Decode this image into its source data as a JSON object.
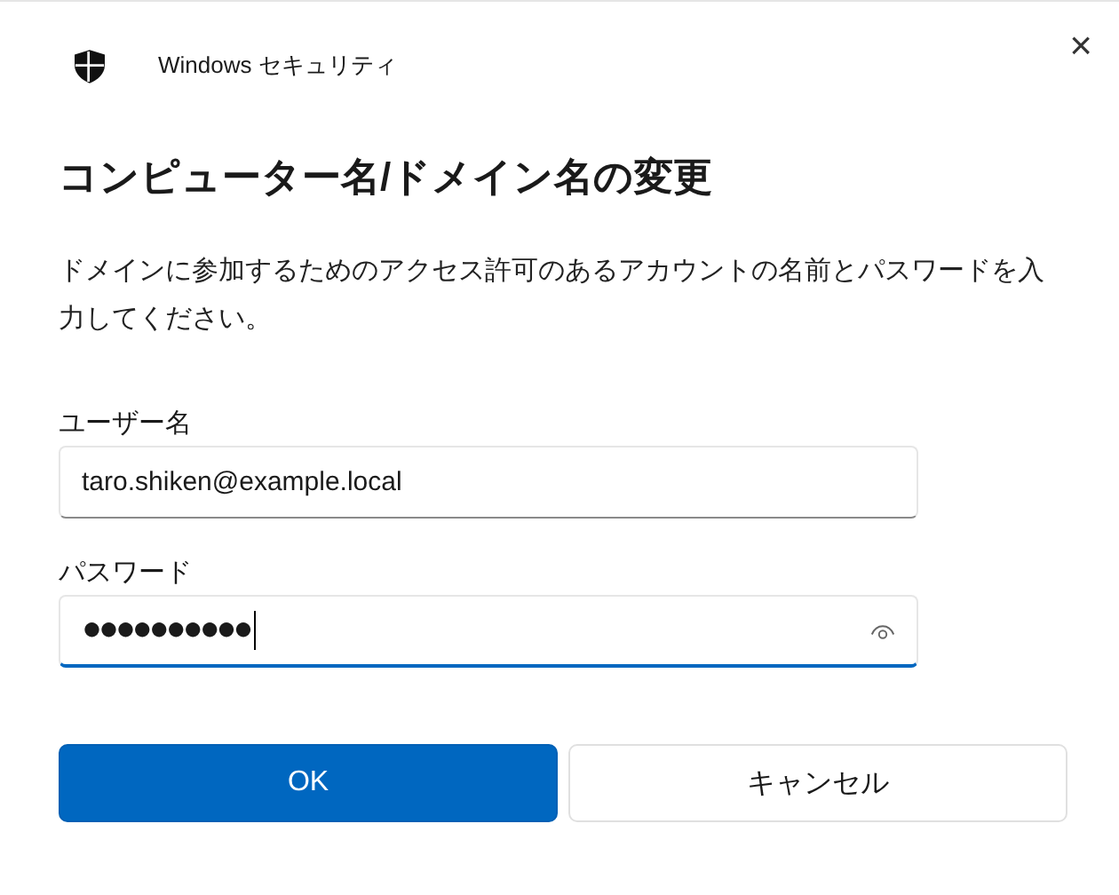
{
  "window": {
    "title": "Windows セキュリティ",
    "close": "×"
  },
  "heading": "コンピューター名/ドメイン名の変更",
  "description": "ドメインに参加するためのアクセス許可のあるアカウントの名前とパスワードを入力してください。",
  "fields": [
    {
      "kind": "text",
      "label": "ユーザー名",
      "value": "taro.shiken@example.local",
      "focused": false
    },
    {
      "kind": "password",
      "label": "パスワード",
      "value": "●●●●●●●●●●",
      "focused": true
    }
  ],
  "buttons": [
    {
      "label": "OK",
      "primary": true
    },
    {
      "label": "キャンセル",
      "primary": false
    }
  ]
}
